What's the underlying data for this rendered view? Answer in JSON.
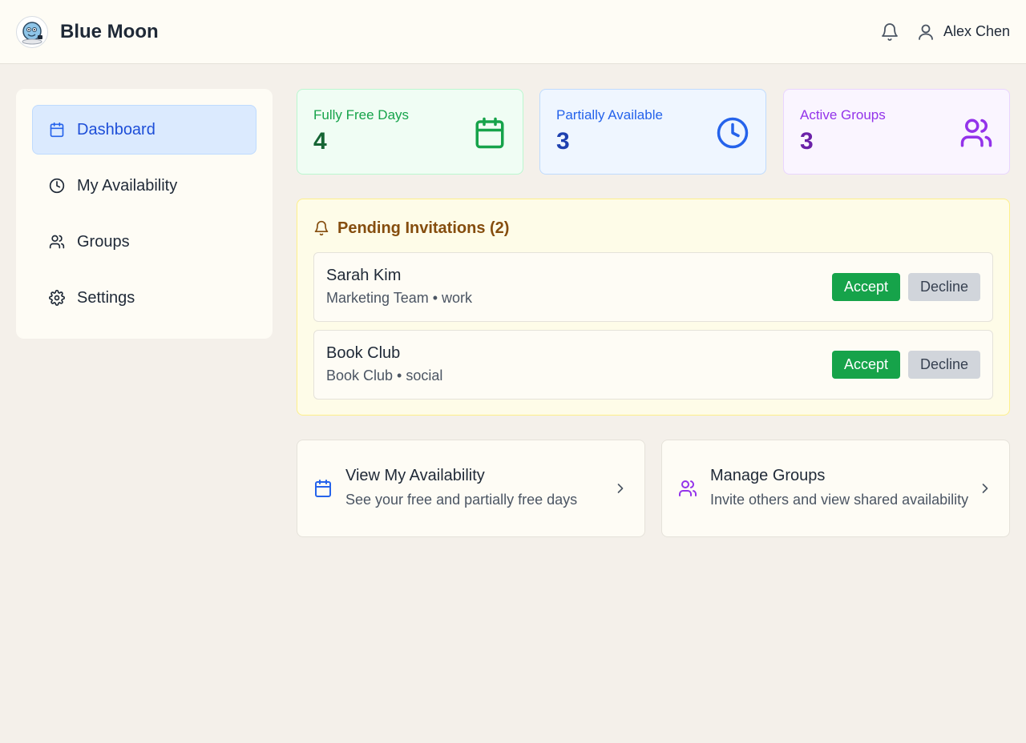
{
  "app": {
    "title": "Blue Moon"
  },
  "header": {
    "user_name": "Alex Chen"
  },
  "sidebar": {
    "items": [
      {
        "label": "Dashboard",
        "icon": "calendar-icon",
        "active": true
      },
      {
        "label": "My Availability",
        "icon": "clock-icon",
        "active": false
      },
      {
        "label": "Groups",
        "icon": "users-icon",
        "active": false
      },
      {
        "label": "Settings",
        "icon": "gear-icon",
        "active": false
      }
    ]
  },
  "stats": [
    {
      "label": "Fully Free Days",
      "value": "4",
      "icon": "calendar-icon",
      "color": "#16a34a"
    },
    {
      "label": "Partially Available",
      "value": "3",
      "icon": "clock-icon",
      "color": "#2563eb"
    },
    {
      "label": "Active Groups",
      "value": "3",
      "icon": "users-icon",
      "color": "#9333ea"
    }
  ],
  "invitations": {
    "title": "Pending Invitations (2)",
    "items": [
      {
        "name": "Sarah Kim",
        "meta": "Marketing Team • work",
        "accept_label": "Accept",
        "decline_label": "Decline"
      },
      {
        "name": "Book Club",
        "meta": "Book Club • social",
        "accept_label": "Accept",
        "decline_label": "Decline"
      }
    ]
  },
  "quick_links": [
    {
      "title": "View My Availability",
      "subtitle": "See your free and partially free days",
      "icon": "calendar-icon",
      "color": "#2563eb"
    },
    {
      "title": "Manage Groups",
      "subtitle": "Invite others and view shared availability",
      "icon": "users-icon",
      "color": "#9333ea"
    }
  ],
  "colors": {
    "accent": "#2563eb",
    "accept": "#16a34a",
    "warning_bg": "#fefce8"
  }
}
